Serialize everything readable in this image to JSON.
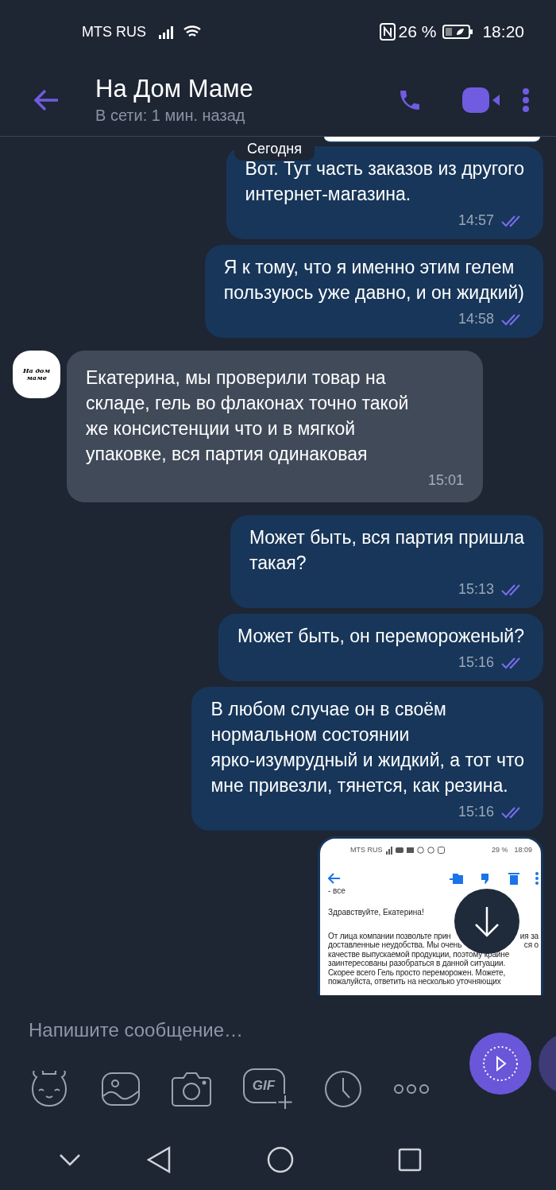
{
  "status_bar": {
    "carrier": "MTS RUS",
    "battery": "26 %",
    "time": "18:20"
  },
  "header": {
    "title": "На Дом Маме",
    "subtitle": "В сети: 1 мин. назад"
  },
  "date_divider": "Сегодня",
  "messages": [
    {
      "kind": "outgoing",
      "text": "Вот. Тут часть заказов из другого\nинтернет-магазина.",
      "time": "14:57",
      "read": true
    },
    {
      "kind": "outgoing",
      "text": "Я к тому, что я именно этим гелем\nпользуюсь уже давно, и он жидкий)",
      "time": "14:58",
      "read": true
    },
    {
      "kind": "incoming",
      "avatar_text": "На дом маме",
      "text": "Екатерина, мы проверили товар на\nскладе, гель во флаконах точно такой\nже консистенции что и в мягкой\nупаковке, вся партия одинаковая",
      "time": "15:01"
    },
    {
      "kind": "outgoing",
      "text": "Может быть, вся партия пришла\nтакая?",
      "time": "15:13",
      "read": true
    },
    {
      "kind": "outgoing",
      "text": "Может быть, он перемороженый?",
      "time": "15:16",
      "read": true
    },
    {
      "kind": "outgoing",
      "text": "В любом случае он в своём\nнормальном состоянии\nярко-изумрудный и жидкий, а тот что\nмне привезли, тянется, как резина.",
      "time": "15:16",
      "read": true
    },
    {
      "kind": "screenshot",
      "status": {
        "carrier": "MTS RUS",
        "battery": "29 %",
        "time": "18:09"
      },
      "cut_line": "- все",
      "greeting": "Здравствуйте, Екатерина!",
      "lines": [
        {
          "left": "От лица компании позвольте прин",
          "right": "ия за"
        },
        {
          "left": "доставленные неудобства. Мы очень",
          "right": "ся о"
        },
        {
          "left": "качестве выпускаемой продукции, поэтому крайне"
        },
        {
          "left": "заинтересованы разобраться в данной ситуации."
        },
        {
          "left": "Скорее всего Гель просто переморожен. Можете,"
        },
        {
          "left": "пожалуйста,  ответить на несколько уточняющих"
        }
      ]
    }
  ],
  "composer": {
    "placeholder": "Напишите сообщение…",
    "gif_label": "GIF"
  }
}
